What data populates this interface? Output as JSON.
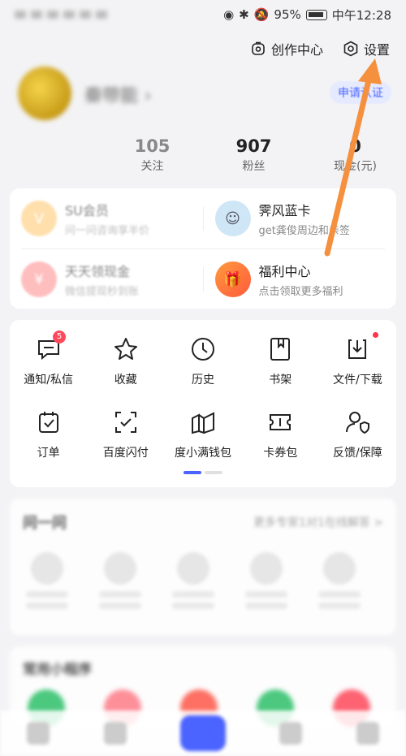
{
  "status": {
    "battery": "95%",
    "time": "中午12:28"
  },
  "top_actions": {
    "create_center": "创作中心",
    "settings": "设置"
  },
  "profile": {
    "username": "秦带能",
    "apply_button": "申请认证"
  },
  "stats": [
    {
      "value": "",
      "label": ""
    },
    {
      "value": "105",
      "label": "关注"
    },
    {
      "value": "907",
      "label": "粉丝"
    },
    {
      "value": "0",
      "label": "现金(元)"
    }
  ],
  "member": {
    "svip_title": "SU会员",
    "svip_sub": "问一问咨询享半价",
    "card_title": "霁风蓝卡",
    "card_sub": "get龚俊周边和亲签",
    "cash_title": "天天领现金",
    "cash_sub": "微信提现秒到账",
    "benefit_title": "福利中心",
    "benefit_sub": "点击领取更多福利"
  },
  "tools_row1": [
    {
      "label": "通知/私信",
      "icon": "message-icon",
      "badge": "5"
    },
    {
      "label": "收藏",
      "icon": "star-icon"
    },
    {
      "label": "历史",
      "icon": "clock-icon"
    },
    {
      "label": "书架",
      "icon": "bookmark-icon"
    },
    {
      "label": "文件/下载",
      "icon": "download-icon"
    }
  ],
  "tools_row2": [
    {
      "label": "订单",
      "icon": "calendar-check-icon"
    },
    {
      "label": "百度闪付",
      "icon": "scan-check-icon"
    },
    {
      "label": "度小满钱包",
      "icon": "wallet-icon"
    },
    {
      "label": "卡券包",
      "icon": "ticket-icon"
    },
    {
      "label": "反馈/保障",
      "icon": "user-shield-icon"
    }
  ],
  "ask": {
    "title": "问一问",
    "more": "更多专家1对1在线解答 >"
  },
  "mini": {
    "title": "常用小程序"
  }
}
